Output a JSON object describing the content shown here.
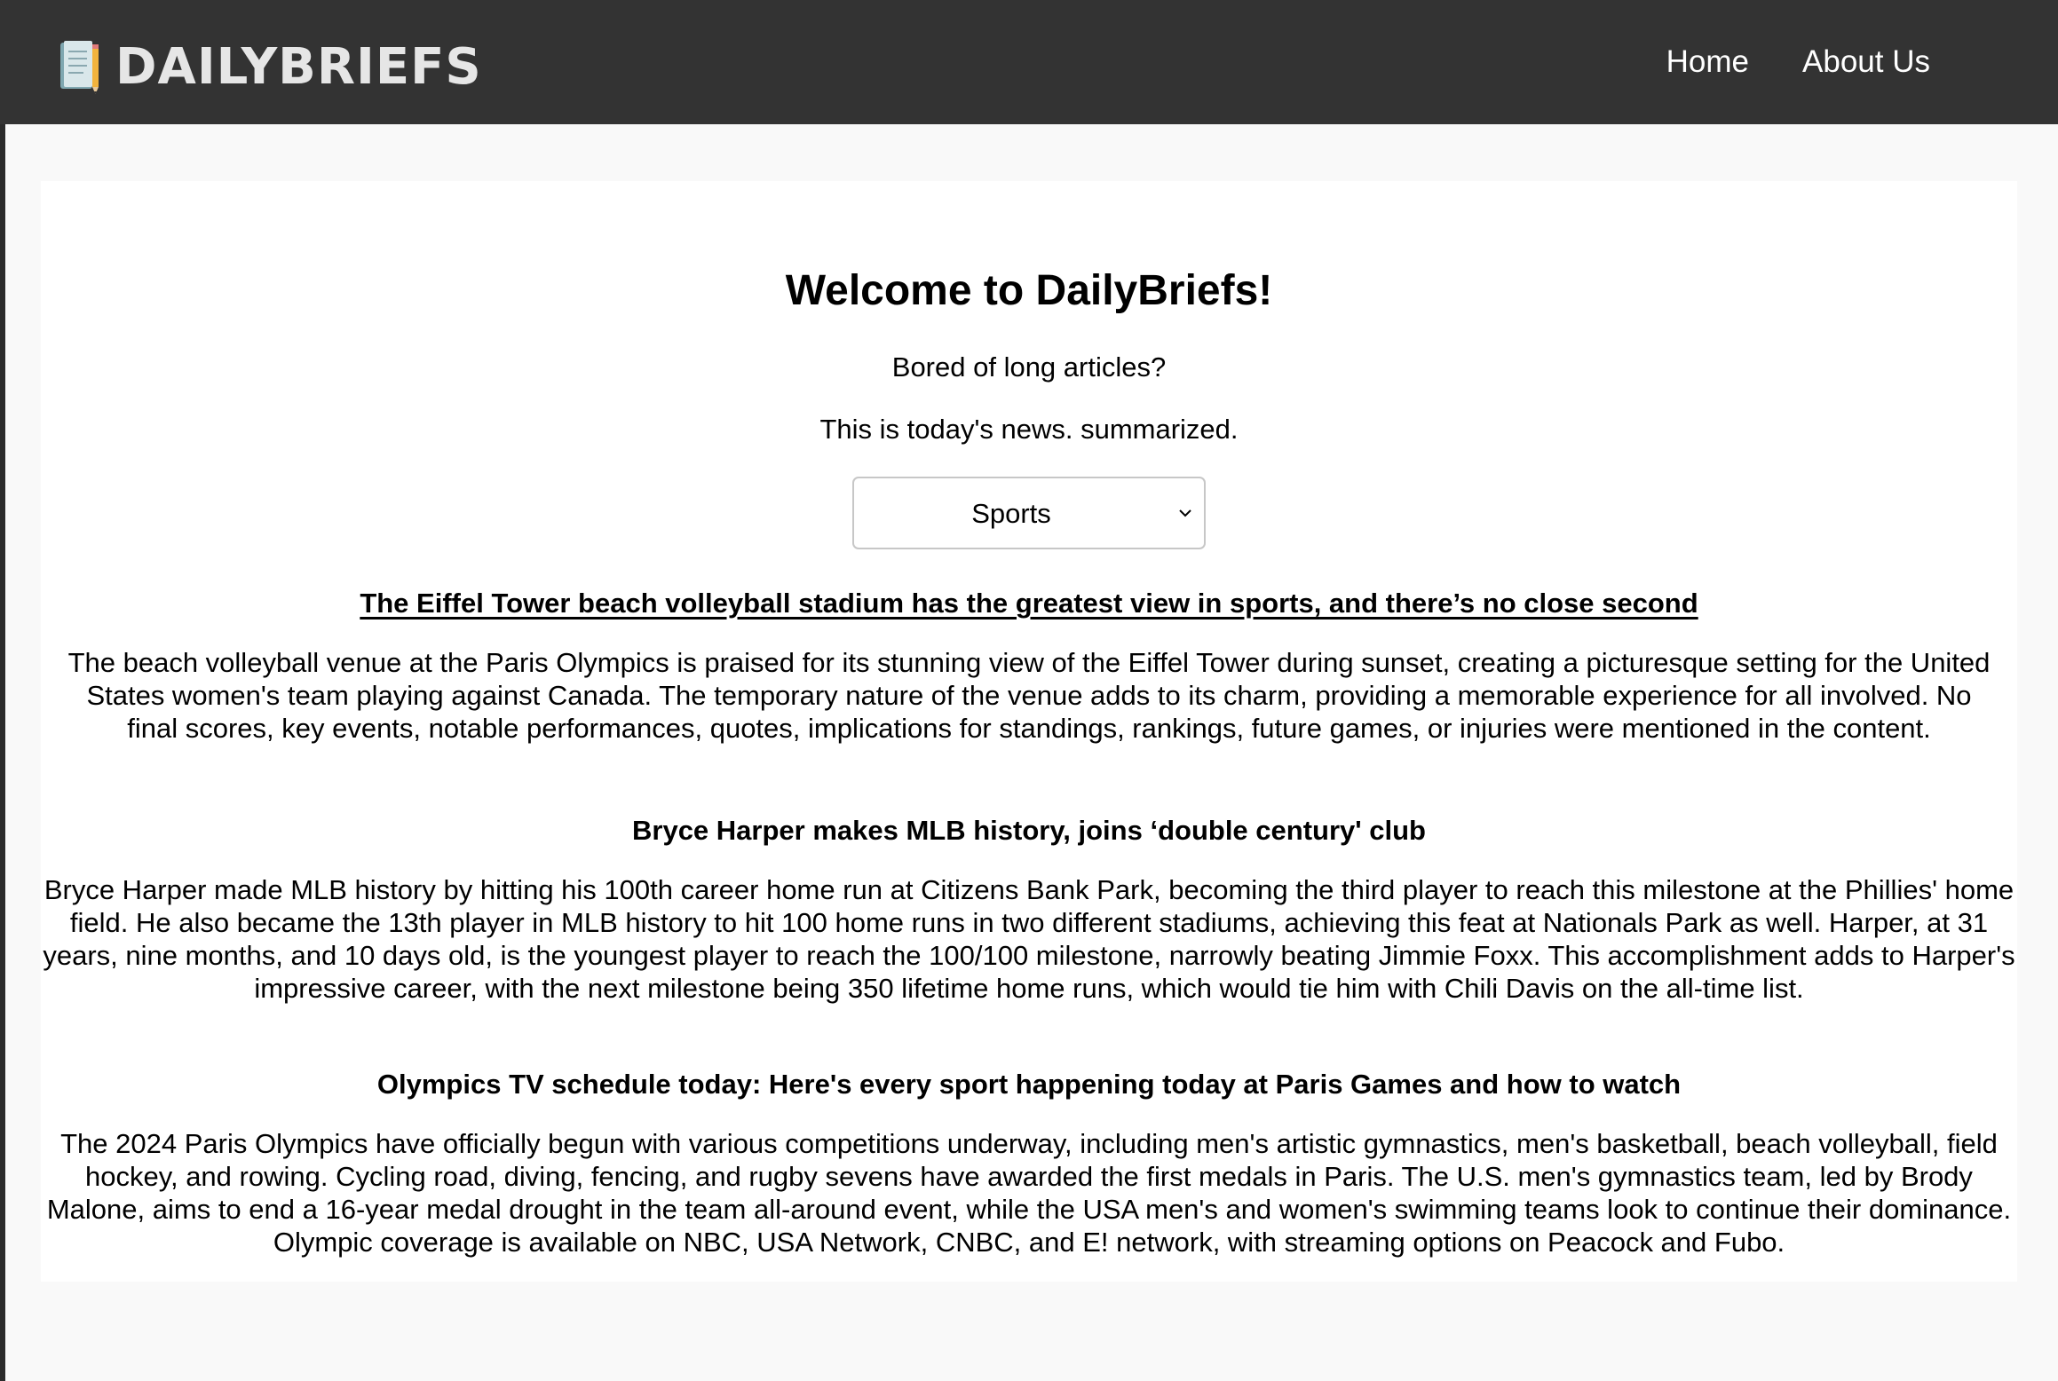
{
  "brand": {
    "name": "DAILYBRIEFS",
    "icon": "notepad-pencil-icon"
  },
  "nav": {
    "items": [
      {
        "label": "Home"
      },
      {
        "label": "About Us"
      }
    ]
  },
  "hero": {
    "title": "Welcome to DailyBriefs!",
    "tagline_1": "Bored of long articles?",
    "tagline_2": "This is today's news. summarized."
  },
  "category_select": {
    "selected": "Sports",
    "icon": "chevron-down-icon"
  },
  "articles": [
    {
      "title": "The Eiffel Tower beach volleyball stadium has the greatest view in sports, and there’s no close second",
      "summary": "The beach volleyball venue at the Paris Olympics is praised for its stunning view of the Eiffel Tower during sunset, creating a picturesque setting for the United States women's team playing against Canada. The temporary nature of the venue adds to its charm, providing a memorable experience for all involved. No final scores, key events, notable performances, quotes, implications for standings, rankings, future games, or injuries were mentioned in the content."
    },
    {
      "title": "Bryce Harper makes MLB history, joins ‘double century' club",
      "summary": "Bryce Harper made MLB history by hitting his 100th career home run at Citizens Bank Park, becoming the third player to reach this milestone at the Phillies' home field. He also became the 13th player in MLB history to hit 100 home runs in two different stadiums, achieving this feat at Nationals Park as well. Harper, at 31 years, nine months, and 10 days old, is the youngest player to reach the 100/100 milestone, narrowly beating Jimmie Foxx. This accomplishment adds to Harper's impressive career, with the next milestone being 350 lifetime home runs, which would tie him with Chili Davis on the all-time list."
    },
    {
      "title": "Olympics TV schedule today: Here's every sport happening today at Paris Games and how to watch",
      "summary": "The 2024 Paris Olympics have officially begun with various competitions underway, including men's artistic gymnastics, men's basketball, beach volleyball, field hockey, and rowing. Cycling road, diving, fencing, and rugby sevens have awarded the first medals in Paris. The U.S. men's gymnastics team, led by Brody Malone, aims to end a 16-year medal drought in the team all-around event, while the USA men's and women's swimming teams look to continue their dominance. Olympic coverage is available on NBC, USA Network, CNBC, and E! network, with streaming options on Peacock and Fubo."
    }
  ],
  "colors": {
    "topbar": "#333333",
    "page_bg": "#f9f9f9",
    "card_bg": "#ffffff",
    "nav_text": "#ffffff",
    "brand_text": "#e6e6e6"
  }
}
